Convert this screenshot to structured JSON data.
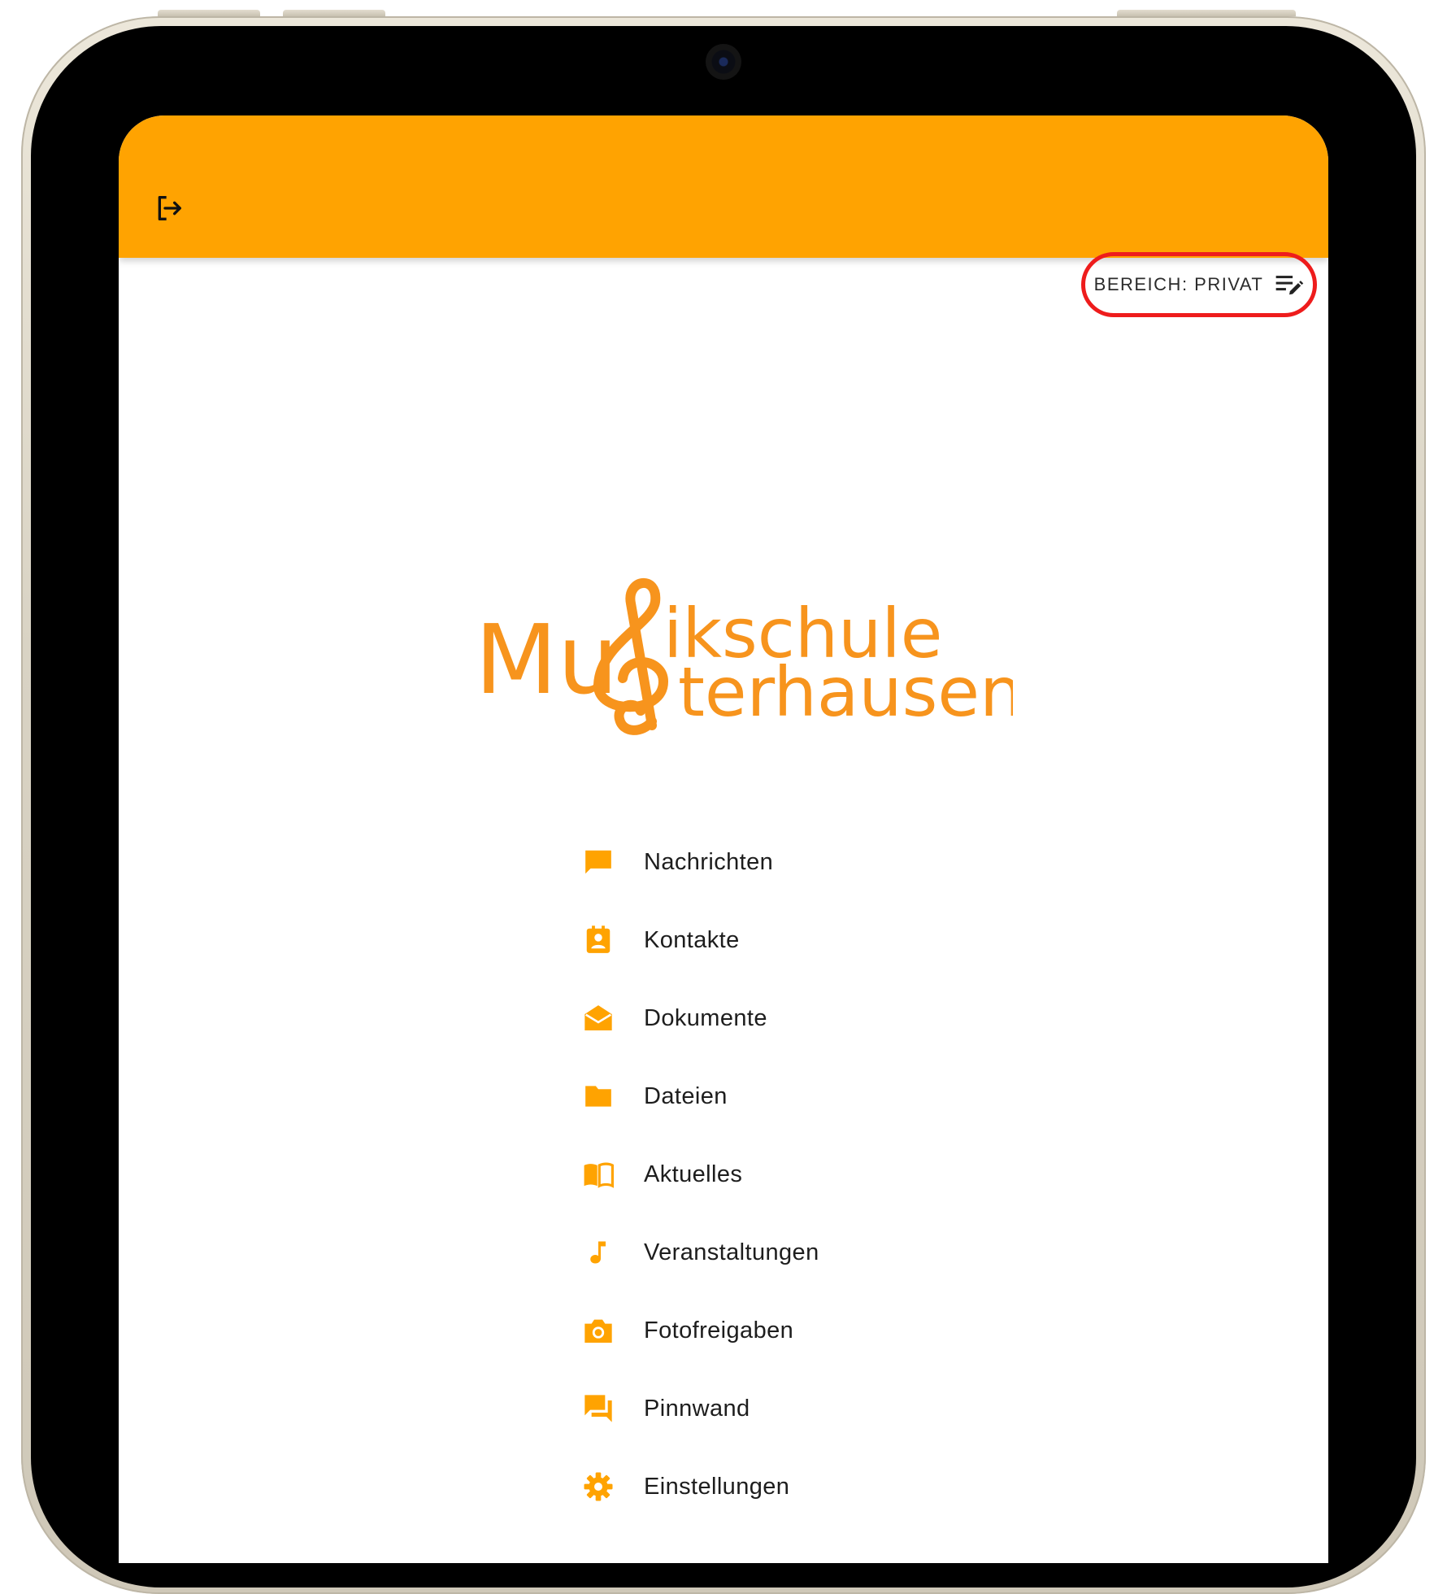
{
  "app_bar": {
    "logout_icon": "logout-icon",
    "color": "#ffa301"
  },
  "area_switch": {
    "label": "BEREICH: PRIVAT",
    "icon": "edit-list-icon",
    "highlight_color": "#ee1c1c"
  },
  "logo": {
    "part_left": "Mu",
    "line1": "ikschule",
    "line2": "terhausen",
    "icon": "treble-clef-icon",
    "color": "#f7941d"
  },
  "menu": {
    "icon_color": "#ffa301",
    "items": [
      {
        "label": "Nachrichten",
        "icon": "chat-bubble-icon"
      },
      {
        "label": "Kontakte",
        "icon": "contact-card-icon"
      },
      {
        "label": "Dokumente",
        "icon": "open-envelope-icon"
      },
      {
        "label": "Dateien",
        "icon": "folder-icon"
      },
      {
        "label": "Aktuelles",
        "icon": "book-open-icon"
      },
      {
        "label": "Veranstaltungen",
        "icon": "music-note-icon"
      },
      {
        "label": "Fotofreigaben",
        "icon": "camera-icon"
      },
      {
        "label": "Pinnwand",
        "icon": "forum-icon"
      },
      {
        "label": "Einstellungen",
        "icon": "gear-icon"
      }
    ]
  }
}
